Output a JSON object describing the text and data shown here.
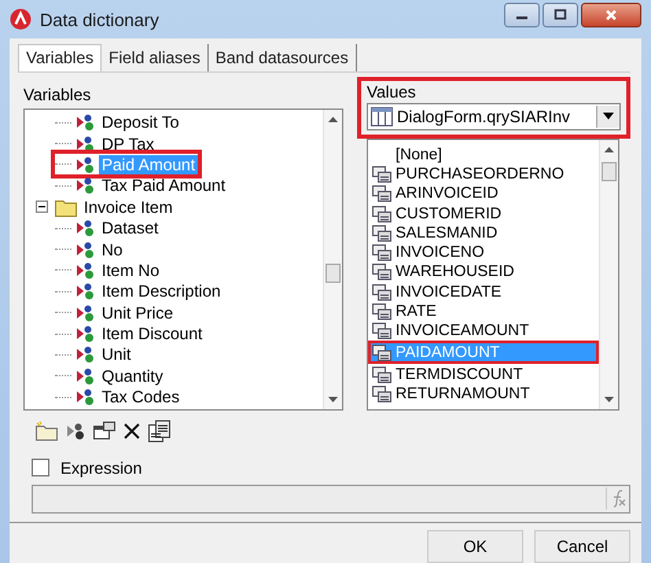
{
  "window": {
    "title": "Data dictionary"
  },
  "tabs": [
    {
      "label": "Variables",
      "selected": true
    },
    {
      "label": "Field aliases",
      "selected": false
    },
    {
      "label": "Band datasources",
      "selected": false
    }
  ],
  "variables": {
    "label": "Variables",
    "tree": [
      {
        "label": "Deposit To",
        "kind": "field",
        "selected": false,
        "highlighted": false
      },
      {
        "label": "DP Tax",
        "kind": "field",
        "selected": false,
        "highlighted": false
      },
      {
        "label": "Paid Amount",
        "kind": "field",
        "selected": true,
        "highlighted": true
      },
      {
        "label": "Tax Paid Amount",
        "kind": "field",
        "selected": false,
        "highlighted": false
      },
      {
        "label": "Invoice Item",
        "kind": "folder",
        "expanded": true,
        "selected": false,
        "highlighted": false,
        "children": [
          {
            "label": "Dataset",
            "kind": "field",
            "selected": false,
            "highlighted": false
          },
          {
            "label": "No",
            "kind": "field",
            "selected": false,
            "highlighted": false
          },
          {
            "label": "Item No",
            "kind": "field",
            "selected": false,
            "highlighted": false
          },
          {
            "label": "Item Description",
            "kind": "field",
            "selected": false,
            "highlighted": false
          },
          {
            "label": "Unit Price",
            "kind": "field",
            "selected": false,
            "highlighted": false
          },
          {
            "label": "Item Discount",
            "kind": "field",
            "selected": false,
            "highlighted": false
          },
          {
            "label": "Unit",
            "kind": "field",
            "selected": false,
            "highlighted": false
          },
          {
            "label": "Quantity",
            "kind": "field",
            "selected": false,
            "highlighted": false
          },
          {
            "label": "Tax Codes",
            "kind": "field",
            "selected": false,
            "highlighted": false
          }
        ]
      }
    ]
  },
  "values": {
    "label": "Values",
    "highlighted": true,
    "source": "DialogForm.qrySIARInv",
    "items": [
      {
        "label": "[None]",
        "kind": "none",
        "selected": false,
        "highlighted": false
      },
      {
        "label": "PURCHASEORDERNO",
        "kind": "field",
        "selected": false,
        "highlighted": false
      },
      {
        "label": "ARINVOICEID",
        "kind": "field",
        "selected": false,
        "highlighted": false
      },
      {
        "label": "CUSTOMERID",
        "kind": "field",
        "selected": false,
        "highlighted": false
      },
      {
        "label": "SALESMANID",
        "kind": "field",
        "selected": false,
        "highlighted": false
      },
      {
        "label": "INVOICENO",
        "kind": "field",
        "selected": false,
        "highlighted": false
      },
      {
        "label": "WAREHOUSEID",
        "kind": "field",
        "selected": false,
        "highlighted": false
      },
      {
        "label": "INVOICEDATE",
        "kind": "field",
        "selected": false,
        "highlighted": false
      },
      {
        "label": "RATE",
        "kind": "field",
        "selected": false,
        "highlighted": false
      },
      {
        "label": "INVOICEAMOUNT",
        "kind": "field",
        "selected": false,
        "highlighted": false
      },
      {
        "label": "PAIDAMOUNT",
        "kind": "field",
        "selected": true,
        "highlighted": true
      },
      {
        "label": "TERMDISCOUNT",
        "kind": "field",
        "selected": false,
        "highlighted": false
      },
      {
        "label": "RETURNAMOUNT",
        "kind": "field",
        "selected": false,
        "highlighted": false
      }
    ]
  },
  "expression": {
    "label": "Expression",
    "checked": false
  },
  "buttons": [
    {
      "label": "OK"
    },
    {
      "label": "Cancel"
    }
  ]
}
